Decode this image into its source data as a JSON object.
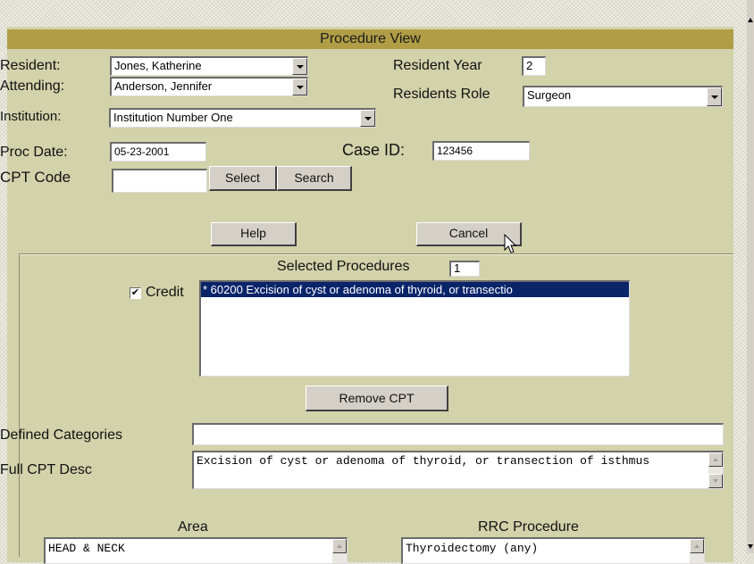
{
  "title": "Procedure View",
  "resident": {
    "label": "Resident:",
    "value": "Jones, Katherine"
  },
  "attending": {
    "label": "Attending:",
    "value": "Anderson, Jennifer"
  },
  "institution": {
    "label": "Institution:",
    "value": "Institution Number One"
  },
  "resident_year": {
    "label": "Resident Year",
    "value": "2"
  },
  "residents_role": {
    "label": "Residents Role",
    "value": "Surgeon"
  },
  "proc_date": {
    "label": "Proc Date:",
    "value": "05-23-2001"
  },
  "case_id": {
    "label": "Case ID:",
    "value": "123456"
  },
  "cpt_code": {
    "label": "CPT Code",
    "value": ""
  },
  "buttons": {
    "select": "Select",
    "search": "Search",
    "help": "Help",
    "cancel": "Cancel",
    "remove_cpt": "Remove CPT"
  },
  "selected_procedures": {
    "label": "Selected Procedures",
    "count": "1"
  },
  "credit": {
    "label": "Credit",
    "checked": true,
    "mark": "✔"
  },
  "procedure_list": [
    "* 60200 Excision of cyst or adenoma of thyroid, or transectio"
  ],
  "defined_categories": {
    "label": "Defined Categories",
    "value": ""
  },
  "full_cpt_desc": {
    "label": "Full CPT Desc",
    "value": "Excision of cyst or adenoma of thyroid, or transection of isthmus"
  },
  "area": {
    "label": "Area",
    "value": "HEAD & NECK"
  },
  "rrc_procedure": {
    "label": "RRC Procedure",
    "value": "Thyroidectomy (any)"
  },
  "colors": {
    "panel": "#d2d2ab",
    "title_bar": "#b09d45",
    "selection": "#0a246a"
  }
}
